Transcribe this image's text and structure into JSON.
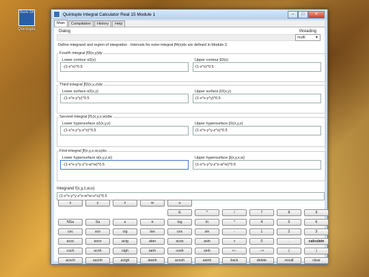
{
  "desktop": {
    "icon_label": "Quintuple",
    "icon_text": "Tools 5h"
  },
  "window": {
    "title": "Quintuple Integral Calculator Real 15 Module 1",
    "btn_min": "–",
    "btn_max": "□",
    "btn_close": "✕"
  },
  "tabs": [
    "Main",
    "Compilation",
    "History",
    "Help"
  ],
  "dialog": {
    "label": "Dialog",
    "threading_label": "threading",
    "threading_value": "multi"
  },
  "define_text": "Define integrand and region of integration . Intervals for outer integral ∫f4(x)dx are defined in Module 2.",
  "groups": [
    {
      "title": "Fourth integral ∫f3(x,y)dy",
      "lower_label": "Lower contour α3(x)",
      "lower_value": "-(1-x^x)^0.5",
      "upper_label": "Upper contour β3(x)",
      "upper_value": "(1-x^x)^0.5"
    },
    {
      "title": "Third integral ∫f2(x,y,z)dz",
      "lower_label": "Lower surface α2(x,y)",
      "lower_value": "-(1-x^x-y^y)^0.5",
      "upper_label": "Upper surface β2(x,y)",
      "upper_value": "(1-x^x-y^y)^0.5"
    },
    {
      "title": "Second integral ∫f1(x,y,z,w)dw",
      "lower_label": "Lower hypersurface α1(x,y,z)",
      "lower_value": "-(1-x^x-y^y-z^z)^0.5",
      "upper_label": "Upper hypersurface β1(x,y,z)",
      "upper_value": "(1-x^x-y^y-z^z)^0.5"
    },
    {
      "title": "First integral ∫f(x,y,z,w,u)du",
      "lower_label": "Lower hypersurface α(x,y,z,w)",
      "lower_value": "-(1-x^x-y^y-z^z-w^w)^0.5",
      "upper_label": "Upper hypersurface β(x,y,z,w)",
      "upper_value": "(1-x^x-y^y-z^z-w^w)^0.5"
    }
  ],
  "integrand": {
    "label": "Integrand f(x,y,z,w,u)",
    "value": "(1-x^x-y^y-z^z-w^w-u^u)^0.5"
  },
  "keys": {
    "row1": [
      "x",
      "y",
      "z",
      "w",
      "u"
    ],
    "row2": [
      "E",
      "^",
      "/",
      "7",
      "8",
      "9"
    ],
    "row3": [
      "NSa",
      "Sa",
      "e",
      "π",
      "log",
      "ln",
      "*",
      "4",
      "5",
      "6"
    ],
    "row4": [
      "csc",
      "scn",
      "ctg",
      "tan",
      "cos",
      "sin",
      "-",
      "1",
      "2",
      "3"
    ],
    "row5": [
      "acsc",
      "ascn",
      "actg",
      "atan",
      "acos",
      "asin",
      "+",
      "0",
      ".",
      "calculate"
    ],
    "row6": [
      "csch",
      "scnh",
      "ctgh",
      "tanh",
      "cosh",
      "sinh",
      "<--",
      "-->",
      "(",
      ")"
    ],
    "row7": [
      "acsch",
      "ascnh",
      "actgh",
      "atanh",
      "acosh",
      "asinh",
      "back",
      "delete",
      "result",
      "clear"
    ]
  }
}
